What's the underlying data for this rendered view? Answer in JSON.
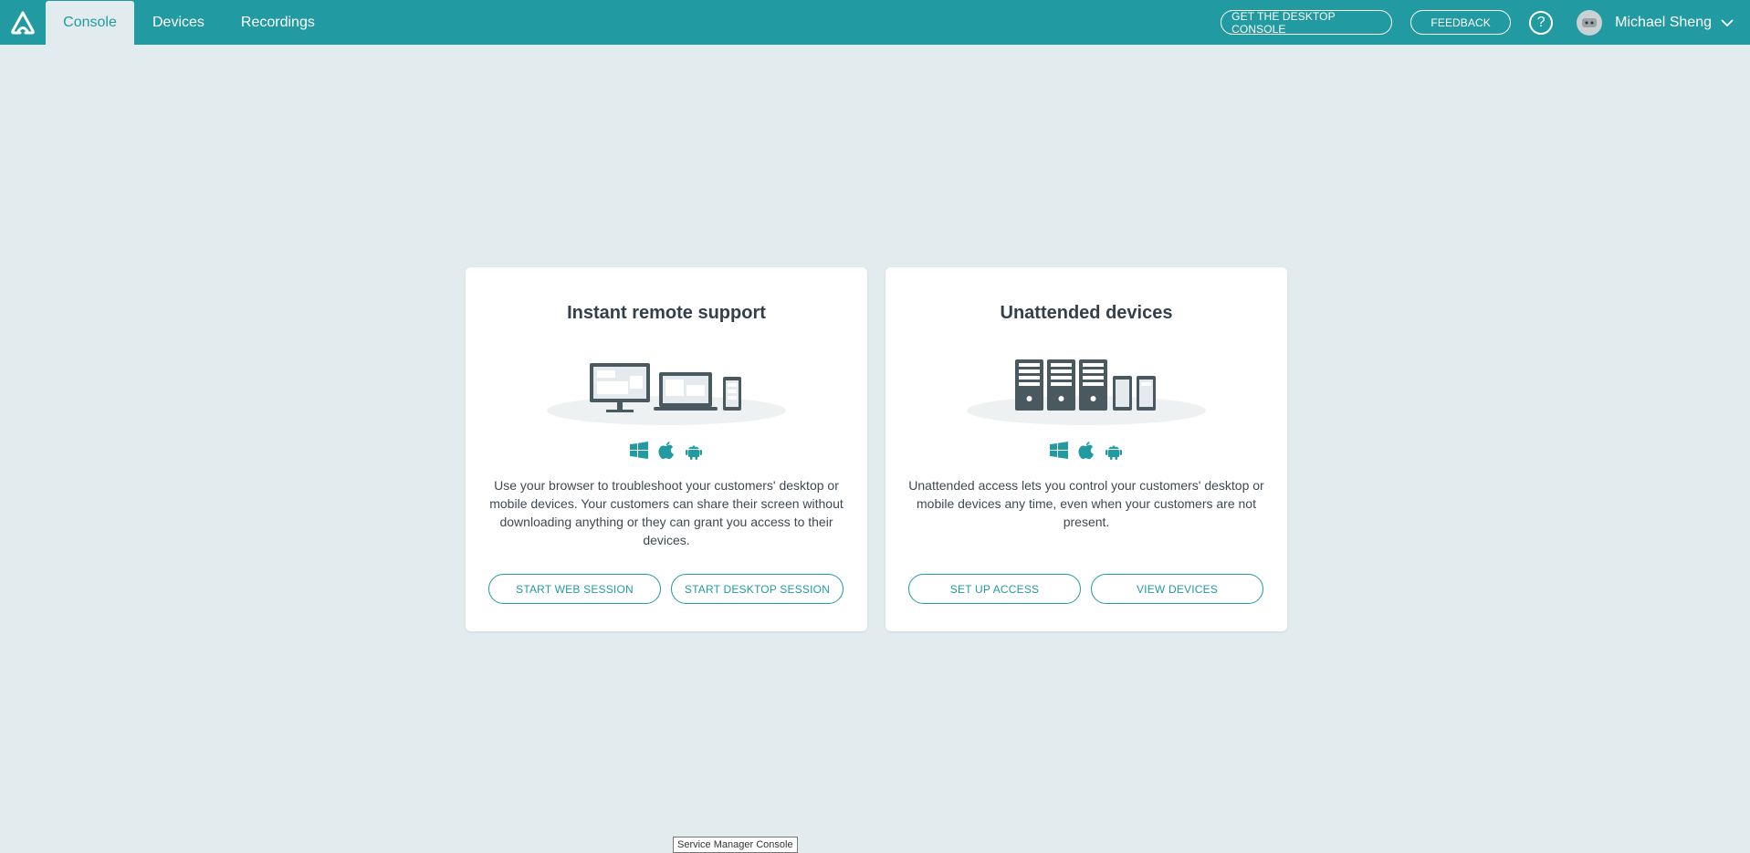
{
  "nav": {
    "tabs": [
      {
        "label": "Console"
      },
      {
        "label": "Devices"
      },
      {
        "label": "Recordings"
      }
    ],
    "desktop_console_label": "GET THE DESKTOP CONSOLE",
    "feedback_label": "FEEDBACK",
    "help_label": "?",
    "user_name": "Michael Sheng"
  },
  "cards": [
    {
      "title": "Instant remote support",
      "description": "Use your browser to troubleshoot your customers' desktop or mobile devices. Your customers can share their screen without downloading anything or they can grant you access to their devices.",
      "buttons": [
        "START WEB SESSION",
        "START DESKTOP SESSION"
      ],
      "os_icons": [
        "windows-icon",
        "apple-icon",
        "android-icon"
      ]
    },
    {
      "title": "Unattended devices",
      "description": "Unattended access lets you control your customers' desktop or mobile devices any time, even when your customers are not present.",
      "buttons": [
        "SET UP ACCESS",
        "VIEW DEVICES"
      ],
      "os_icons": [
        "windows-icon",
        "apple-icon",
        "android-icon"
      ]
    }
  ],
  "tooltip": "Service Manager Console",
  "colors": {
    "accent": "#229aa1",
    "background": "#e2ecef",
    "icon_dark": "#4a5860"
  }
}
